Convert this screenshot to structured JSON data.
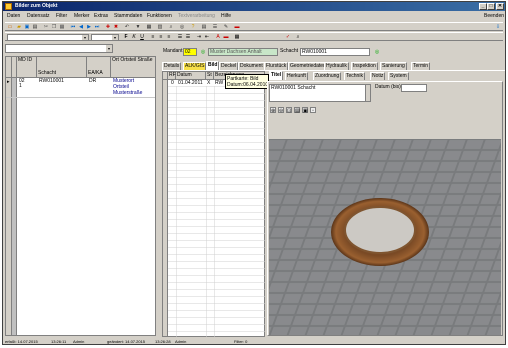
{
  "window": {
    "title": "Bilder zum Objekt",
    "controls": [
      "_",
      "□",
      "✕"
    ]
  },
  "menu": {
    "items": [
      "Daten",
      "Datensatz",
      "Filter",
      "Merker",
      "Extras",
      "Stammdaten",
      "Funktionen",
      "Textverarbeitung",
      "Hilfe"
    ],
    "right": "Beenden"
  },
  "main": {
    "mandant_label": "Mandant",
    "mandant_value": "02",
    "mandant_name": "Muster Dachsen Anhalt",
    "schacht_label": "Schacht",
    "schacht_value": "RW010001"
  },
  "grid1": {
    "headers": [
      "MD ID",
      "Schacht",
      "EA/KA",
      "Ort Ortsteil Straße"
    ],
    "rows": [
      {
        "md": "02",
        "id": "1",
        "schacht": "RW010001",
        "eaka": "DR",
        "ort": "Musterort",
        "ortsteil": "Ortsteil",
        "strasse": "Musterstraße"
      }
    ]
  },
  "tabs_row1": [
    "Details",
    "ALK/GIS",
    "Bild",
    "Deckel",
    "Dokument",
    "Flurstück",
    "Geometriedaten",
    "Hydraulik",
    "Inspektion",
    "Sanierung",
    "Termin"
  ],
  "tabs_row2": [
    "Titel",
    "Herkunft",
    "Zuordnung",
    "Technik",
    "Notiz",
    "System"
  ],
  "grid2": {
    "headers": [
      "RF",
      "Datum",
      "St",
      "Bezeichnung"
    ],
    "rows": [
      {
        "rf": "0",
        "datum": "01.04.2011",
        "st": "X",
        "bez": "RW"
      }
    ]
  },
  "tooltip": {
    "line1": "Partkarte: Bild",
    "line2": "Datum:06.04.2010"
  },
  "detail": {
    "titel_value": "RW010001 Schacht",
    "datum_label": "Datum (bis)"
  },
  "status": {
    "erfasst": "erfaßt: 14.07.2015",
    "erfasst_time": "13:26:11",
    "erfasst_user": "Admin",
    "geaendert": "geändert: 14.07.2015",
    "geaendert_time": "13:26:28",
    "geaendert_user": "Admin",
    "filter": "Filter: 0"
  },
  "icons": {
    "tb1": [
      "new",
      "open",
      "save",
      "print",
      "cut",
      "copy",
      "paste",
      "undo",
      "first",
      "prev",
      "next",
      "last",
      "add",
      "delete",
      "search",
      "refresh",
      "help",
      "exit"
    ],
    "tb2": [
      "bold",
      "italic",
      "underline",
      "align-left",
      "align-center",
      "align-right"
    ]
  }
}
